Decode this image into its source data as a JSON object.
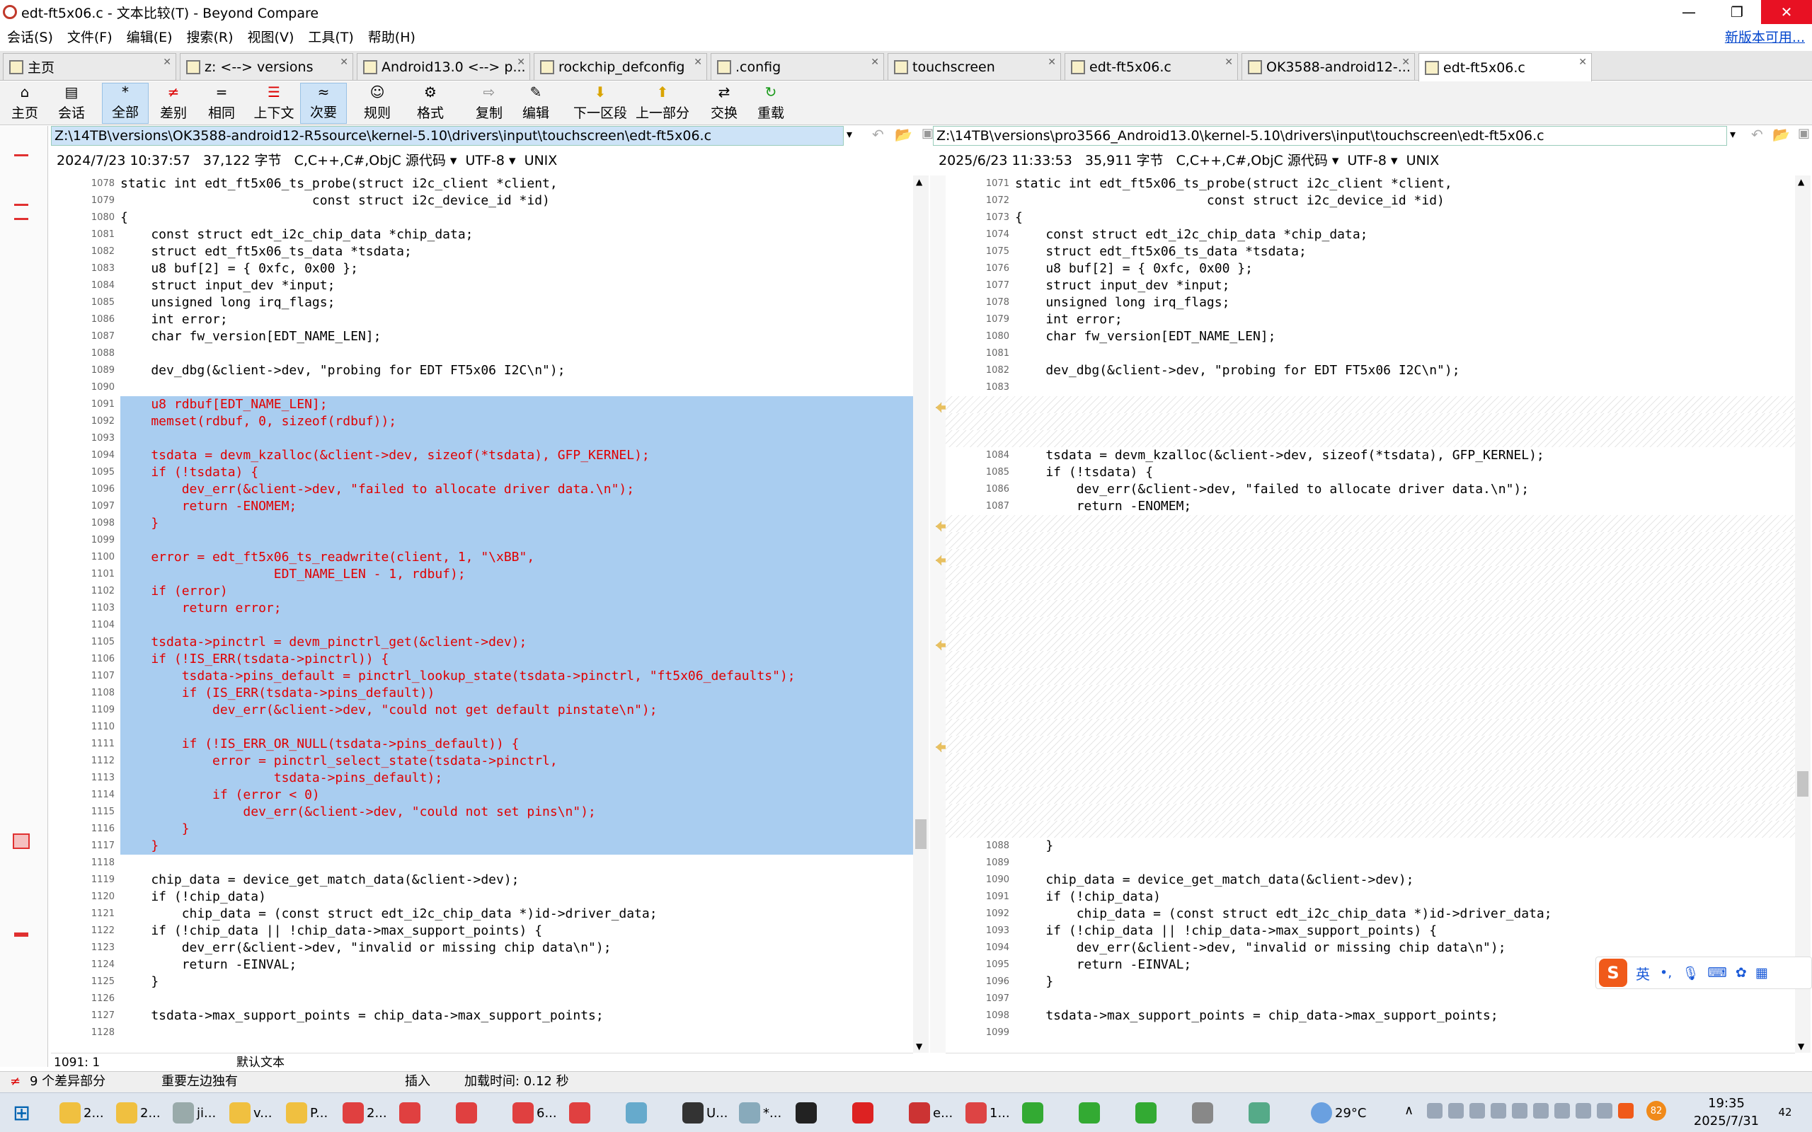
{
  "window": {
    "title": "edt-ft5x06.c - 文本比较(T) - Beyond Compare",
    "min": "—",
    "max": "❐",
    "close": "✕"
  },
  "menu": {
    "items": [
      "会话(S)",
      "文件(F)",
      "编辑(E)",
      "搜索(R)",
      "视图(V)",
      "工具(T)",
      "帮助(H)"
    ],
    "new_version": "新版本可用..."
  },
  "tabs": [
    {
      "label": "主页"
    },
    {
      "label": "z: <--> versions"
    },
    {
      "label": "Android13.0 <--> p..."
    },
    {
      "label": "rockchip_defconfig"
    },
    {
      "label": ".config"
    },
    {
      "label": "touchscreen"
    },
    {
      "label": "edt-ft5x06.c"
    },
    {
      "label": "OK3588-android12-..."
    },
    {
      "label": "edt-ft5x06.c"
    }
  ],
  "toolbar": [
    {
      "label": "主页",
      "icon": "home-icon"
    },
    {
      "label": "会话",
      "icon": "session-icon"
    },
    {
      "label": "全部",
      "icon": "all-icon"
    },
    {
      "label": "差别",
      "icon": "diffs-icon"
    },
    {
      "label": "相同",
      "icon": "same-icon"
    },
    {
      "label": "上下文",
      "icon": "context-icon"
    },
    {
      "label": "次要",
      "icon": "minor-icon"
    },
    {
      "label": "规则",
      "icon": "rules-icon"
    },
    {
      "label": "格式",
      "icon": "format-icon"
    },
    {
      "label": "复制",
      "icon": "copy-icon"
    },
    {
      "label": "编辑",
      "icon": "edit-icon"
    },
    {
      "label": "下一区段",
      "icon": "next-section-icon"
    },
    {
      "label": "上一部分",
      "icon": "prev-section-icon"
    },
    {
      "label": "交换",
      "icon": "swap-icon"
    },
    {
      "label": "重载",
      "icon": "reload-icon"
    }
  ],
  "left": {
    "path": "Z:\\14TB\\versions\\OK3588-android12-R5source\\kernel-5.10\\drivers\\input\\touchscreen\\edt-ft5x06.c",
    "date": "2024/7/23 10:37:57",
    "size": "37,122 字节",
    "lang": "C,C++,C#,ObjC 源代码",
    "encoding": "UTF-8",
    "eol": "UNIX",
    "cursor": "1091: 1",
    "mode": "默认文本",
    "lines": [
      {
        "n": "1078",
        "t": "static int edt_ft5x06_ts_probe(struct i2c_client *client,",
        "d": false
      },
      {
        "n": "1079",
        "t": "                         const struct i2c_device_id *id)",
        "d": false
      },
      {
        "n": "1080",
        "t": "{",
        "d": false
      },
      {
        "n": "1081",
        "t": "    const struct edt_i2c_chip_data *chip_data;",
        "d": false
      },
      {
        "n": "1082",
        "t": "    struct edt_ft5x06_ts_data *tsdata;",
        "d": false
      },
      {
        "n": "1083",
        "t": "    u8 buf[2] = { 0xfc, 0x00 };",
        "d": false
      },
      {
        "n": "1084",
        "t": "    struct input_dev *input;",
        "d": false
      },
      {
        "n": "1085",
        "t": "    unsigned long irq_flags;",
        "d": false
      },
      {
        "n": "1086",
        "t": "    int error;",
        "d": false
      },
      {
        "n": "1087",
        "t": "    char fw_version[EDT_NAME_LEN];",
        "d": false
      },
      {
        "n": "1088",
        "t": "",
        "d": false
      },
      {
        "n": "1089",
        "t": "    dev_dbg(&client->dev, \"probing for EDT FT5x06 I2C\\n\");",
        "d": false
      },
      {
        "n": "1090",
        "t": "",
        "d": false
      },
      {
        "n": "1091",
        "t": "    u8 rdbuf[EDT_NAME_LEN];",
        "d": true
      },
      {
        "n": "1092",
        "t": "    memset(rdbuf, 0, sizeof(rdbuf));",
        "d": true
      },
      {
        "n": "1093",
        "t": "",
        "d": true
      },
      {
        "n": "1094",
        "t": "    tsdata = devm_kzalloc(&client->dev, sizeof(*tsdata), GFP_KERNEL);",
        "d": true
      },
      {
        "n": "1095",
        "t": "    if (!tsdata) {",
        "d": true
      },
      {
        "n": "1096",
        "t": "        dev_err(&client->dev, \"failed to allocate driver data.\\n\");",
        "d": true
      },
      {
        "n": "1097",
        "t": "        return -ENOMEM;",
        "d": true
      },
      {
        "n": "1098",
        "t": "    }",
        "d": true
      },
      {
        "n": "1099",
        "t": "",
        "d": true
      },
      {
        "n": "1100",
        "t": "    error = edt_ft5x06_ts_readwrite(client, 1, \"\\xBB\",",
        "d": true
      },
      {
        "n": "1101",
        "t": "                    EDT_NAME_LEN - 1, rdbuf);",
        "d": true
      },
      {
        "n": "1102",
        "t": "    if (error)",
        "d": true
      },
      {
        "n": "1103",
        "t": "        return error;",
        "d": true
      },
      {
        "n": "1104",
        "t": "",
        "d": true
      },
      {
        "n": "1105",
        "t": "    tsdata->pinctrl = devm_pinctrl_get(&client->dev);",
        "d": true
      },
      {
        "n": "1106",
        "t": "    if (!IS_ERR(tsdata->pinctrl)) {",
        "d": true
      },
      {
        "n": "1107",
        "t": "        tsdata->pins_default = pinctrl_lookup_state(tsdata->pinctrl, \"ft5x06_defaults\");",
        "d": true
      },
      {
        "n": "1108",
        "t": "        if (IS_ERR(tsdata->pins_default))",
        "d": true
      },
      {
        "n": "1109",
        "t": "            dev_err(&client->dev, \"could not get default pinstate\\n\");",
        "d": true
      },
      {
        "n": "1110",
        "t": "",
        "d": true
      },
      {
        "n": "1111",
        "t": "        if (!IS_ERR_OR_NULL(tsdata->pins_default)) {",
        "d": true
      },
      {
        "n": "1112",
        "t": "            error = pinctrl_select_state(tsdata->pinctrl,",
        "d": true
      },
      {
        "n": "1113",
        "t": "                    tsdata->pins_default);",
        "d": true
      },
      {
        "n": "1114",
        "t": "            if (error < 0)",
        "d": true
      },
      {
        "n": "1115",
        "t": "                dev_err(&client->dev, \"could not set pins\\n\");",
        "d": true
      },
      {
        "n": "1116",
        "t": "        }",
        "d": true
      },
      {
        "n": "1117",
        "t": "    }",
        "d": true
      },
      {
        "n": "1118",
        "t": "",
        "d": false
      },
      {
        "n": "1119",
        "t": "    chip_data = device_get_match_data(&client->dev);",
        "d": false
      },
      {
        "n": "1120",
        "t": "    if (!chip_data)",
        "d": false
      },
      {
        "n": "1121",
        "t": "        chip_data = (const struct edt_i2c_chip_data *)id->driver_data;",
        "d": false
      },
      {
        "n": "1122",
        "t": "    if (!chip_data || !chip_data->max_support_points) {",
        "d": false
      },
      {
        "n": "1123",
        "t": "        dev_err(&client->dev, \"invalid or missing chip data\\n\");",
        "d": false
      },
      {
        "n": "1124",
        "t": "        return -EINVAL;",
        "d": false
      },
      {
        "n": "1125",
        "t": "    }",
        "d": false
      },
      {
        "n": "1126",
        "t": "",
        "d": false
      },
      {
        "n": "1127",
        "t": "    tsdata->max_support_points = chip_data->max_support_points;",
        "d": false
      },
      {
        "n": "1128",
        "t": "",
        "d": false
      }
    ]
  },
  "right": {
    "path": "Z:\\14TB\\versions\\pro3566_Android13.0\\kernel-5.10\\drivers\\input\\touchscreen\\edt-ft5x06.c",
    "date": "2025/6/23 11:33:53",
    "size": "35,911 字节",
    "lang": "C,C++,C#,ObjC 源代码",
    "encoding": "UTF-8",
    "eol": "UNIX",
    "lines": [
      {
        "n": "1071",
        "t": "static int edt_ft5x06_ts_probe(struct i2c_client *client,",
        "g": false
      },
      {
        "n": "1072",
        "t": "                         const struct i2c_device_id *id)",
        "g": false
      },
      {
        "n": "1073",
        "t": "{",
        "g": false
      },
      {
        "n": "1074",
        "t": "    const struct edt_i2c_chip_data *chip_data;",
        "g": false
      },
      {
        "n": "1075",
        "t": "    struct edt_ft5x06_ts_data *tsdata;",
        "g": false
      },
      {
        "n": "1076",
        "t": "    u8 buf[2] = { 0xfc, 0x00 };",
        "g": false
      },
      {
        "n": "1077",
        "t": "    struct input_dev *input;",
        "g": false
      },
      {
        "n": "1078",
        "t": "    unsigned long irq_flags;",
        "g": false
      },
      {
        "n": "1079",
        "t": "    int error;",
        "g": false
      },
      {
        "n": "1080",
        "t": "    char fw_version[EDT_NAME_LEN];",
        "g": false
      },
      {
        "n": "1081",
        "t": "",
        "g": false
      },
      {
        "n": "1082",
        "t": "    dev_dbg(&client->dev, \"probing for EDT FT5x06 I2C\\n\");",
        "g": false
      },
      {
        "n": "1083",
        "t": "",
        "g": false
      },
      {
        "n": "",
        "t": "",
        "g": true
      },
      {
        "n": "",
        "t": "",
        "g": true
      },
      {
        "n": "",
        "t": "",
        "g": true
      },
      {
        "n": "1084",
        "t": "    tsdata = devm_kzalloc(&client->dev, sizeof(*tsdata), GFP_KERNEL);",
        "g": false
      },
      {
        "n": "1085",
        "t": "    if (!tsdata) {",
        "g": false
      },
      {
        "n": "1086",
        "t": "        dev_err(&client->dev, \"failed to allocate driver data.\\n\");",
        "g": false
      },
      {
        "n": "1087",
        "t": "        return -ENOMEM;",
        "g": false
      },
      {
        "n": "",
        "t": "",
        "g": true
      },
      {
        "n": "",
        "t": "",
        "g": true
      },
      {
        "n": "",
        "t": "",
        "g": true
      },
      {
        "n": "",
        "t": "",
        "g": true
      },
      {
        "n": "",
        "t": "",
        "g": true
      },
      {
        "n": "",
        "t": "",
        "g": true
      },
      {
        "n": "",
        "t": "",
        "g": true
      },
      {
        "n": "",
        "t": "",
        "g": true
      },
      {
        "n": "",
        "t": "",
        "g": true
      },
      {
        "n": "",
        "t": "",
        "g": true
      },
      {
        "n": "",
        "t": "",
        "g": true
      },
      {
        "n": "",
        "t": "",
        "g": true
      },
      {
        "n": "",
        "t": "",
        "g": true
      },
      {
        "n": "",
        "t": "",
        "g": true
      },
      {
        "n": "",
        "t": "",
        "g": true
      },
      {
        "n": "",
        "t": "",
        "g": true
      },
      {
        "n": "",
        "t": "",
        "g": true
      },
      {
        "n": "",
        "t": "",
        "g": true
      },
      {
        "n": "",
        "t": "",
        "g": true
      },
      {
        "n": "1088",
        "t": "    }",
        "g": false
      },
      {
        "n": "1089",
        "t": "",
        "g": false
      },
      {
        "n": "1090",
        "t": "    chip_data = device_get_match_data(&client->dev);",
        "g": false
      },
      {
        "n": "1091",
        "t": "    if (!chip_data)",
        "g": false
      },
      {
        "n": "1092",
        "t": "        chip_data = (const struct edt_i2c_chip_data *)id->driver_data;",
        "g": false
      },
      {
        "n": "1093",
        "t": "    if (!chip_data || !chip_data->max_support_points) {",
        "g": false
      },
      {
        "n": "1094",
        "t": "        dev_err(&client->dev, \"invalid or missing chip data\\n\");",
        "g": false
      },
      {
        "n": "1095",
        "t": "        return -EINVAL;",
        "g": false
      },
      {
        "n": "1096",
        "t": "    }",
        "g": false
      },
      {
        "n": "1097",
        "t": "",
        "g": false
      },
      {
        "n": "1098",
        "t": "    tsdata->max_support_points = chip_data->max_support_points;",
        "g": false
      },
      {
        "n": "1099",
        "t": "",
        "g": false
      }
    ]
  },
  "status": {
    "diffs": "9 个差异部分",
    "importance": "重要左边独有",
    "insert": "插入",
    "load_time": "加载时间: 0.12 秒"
  },
  "taskbar": {
    "items": [
      "2...",
      "2...",
      "ji...",
      "v...",
      "P...",
      "2...",
      "",
      "",
      "6...",
      "",
      "",
      "U...",
      "*...",
      "",
      "",
      "e...",
      "1...",
      "",
      "",
      "",
      "",
      ""
    ],
    "weather": "29°C",
    "time": "19:35",
    "date": "2025/7/31",
    "notif": "42",
    "ime": "英"
  }
}
